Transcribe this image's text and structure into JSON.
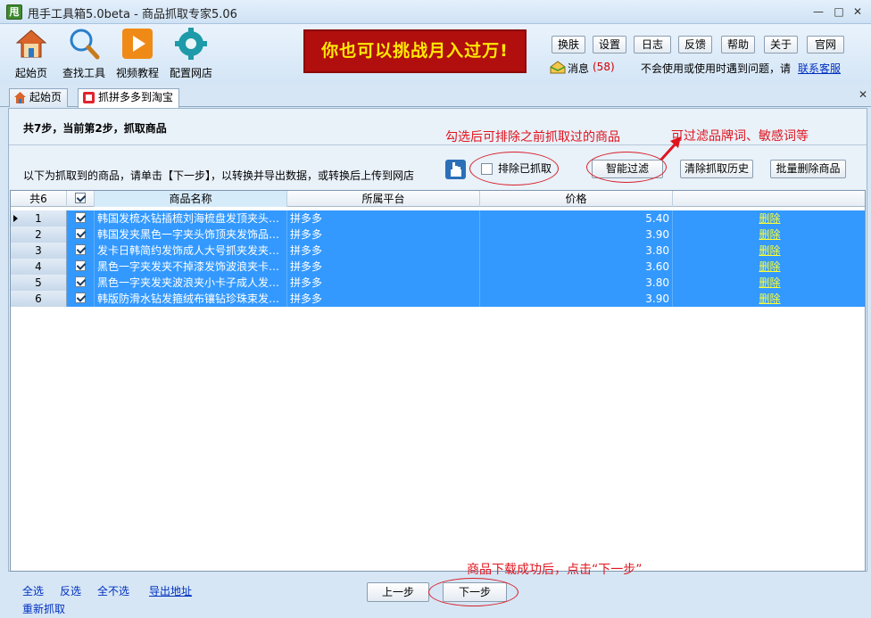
{
  "window": {
    "title": "甩手工具箱5.0beta - 商品抓取专家5.06",
    "app_icon_text": "甩"
  },
  "toolbar": {
    "items": [
      {
        "label": "起始页",
        "icon": "home-icon"
      },
      {
        "label": "查找工具",
        "icon": "search-icon"
      },
      {
        "label": "视频教程",
        "icon": "video-play-icon"
      },
      {
        "label": "配置网店",
        "icon": "gear-icon"
      }
    ],
    "banner": "你也可以挑战月入过万!",
    "buttons": [
      "换肤",
      "设置",
      "日志",
      "反馈",
      "帮助",
      "关于",
      "官网"
    ],
    "message_label": "消息",
    "message_count": "(58)",
    "help_text": "不会使用或使用时遇到问题，请",
    "help_link": "联系客服"
  },
  "tabs": [
    {
      "label": "起始页",
      "icon": "home-icon"
    },
    {
      "label": "抓拼多多到淘宝",
      "icon": "tag-icon"
    }
  ],
  "panel": {
    "step_text": "共7步，当前第2步，抓取商品",
    "hint_text": "以下为抓取到的商品，请单击【下一步】，以转换并导出数据，或转换后上传到网店",
    "exclude_label": "排除已抓取",
    "filter_button": "智能过滤",
    "clear_history_button": "清除抓取历史",
    "batch_delete_button": "批量删除商品",
    "annotations": {
      "exclude_note": "勾选后可排除之前抓取过的商品",
      "filter_note": "可过滤品牌词、敏感词等",
      "next_note": "商品下载成功后，点击“下一步”"
    }
  },
  "grid": {
    "headers": {
      "count": "共6",
      "name": "商品名称",
      "platform": "所属平台",
      "price": "价格"
    },
    "rows": [
      {
        "no": "1",
        "name": "韩国发梳水钻插梳刘海梳盘发顶夹头…",
        "platform": "拼多多",
        "price": "5.40",
        "action": "删除"
      },
      {
        "no": "2",
        "name": "韩国发夹黑色一字夹头饰顶夹发饰品…",
        "platform": "拼多多",
        "price": "3.90",
        "action": "删除"
      },
      {
        "no": "3",
        "name": "发卡日韩简约发饰成人大号抓夹发夹…",
        "platform": "拼多多",
        "price": "3.80",
        "action": "删除"
      },
      {
        "no": "4",
        "name": "黑色一字夹发夹不掉漆发饰波浪夹卡…",
        "platform": "拼多多",
        "price": "3.60",
        "action": "删除"
      },
      {
        "no": "5",
        "name": "黑色一字夹发夹波浪夹小卡子成人发…",
        "platform": "拼多多",
        "price": "3.80",
        "action": "删除"
      },
      {
        "no": "6",
        "name": "韩版防滑水钻发箍绒布镶钻珍珠束发…",
        "platform": "拼多多",
        "price": "3.90",
        "action": "删除"
      }
    ]
  },
  "bottom": {
    "select_all": "全选",
    "invert": "反选",
    "select_none": "全不选",
    "export_link": "导出地址",
    "refetch": "重新抓取",
    "prev_button": "上一步",
    "next_button": "下一步"
  },
  "colors": {
    "selection": "#3399ff",
    "banner_bg": "#b10e0e",
    "banner_text": "#ffe900",
    "annotation": "#e0141e",
    "link": "#0030c0"
  }
}
